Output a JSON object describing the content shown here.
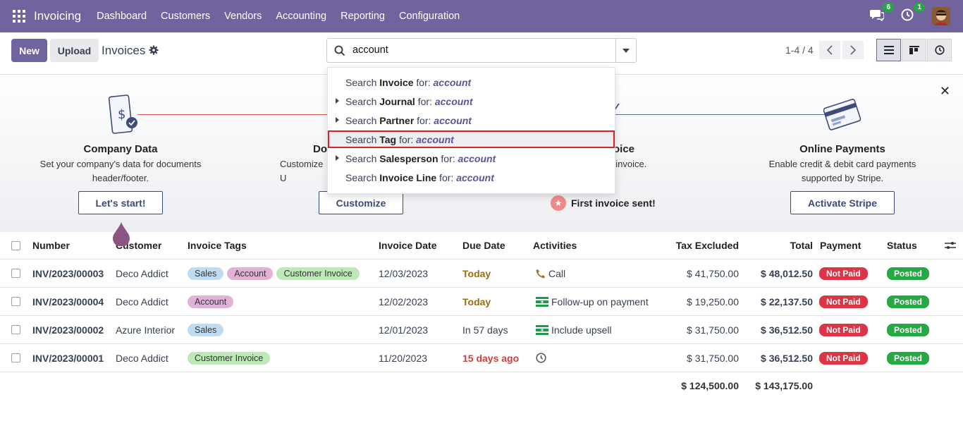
{
  "navbar": {
    "app_name": "Invoicing",
    "menu": [
      "Dashboard",
      "Customers",
      "Vendors",
      "Accounting",
      "Reporting",
      "Configuration"
    ],
    "messages_count": "6",
    "activities_count": "1",
    "bg_color": "#71639e"
  },
  "control": {
    "new_label": "New",
    "upload_label": "Upload",
    "breadcrumb": "Invoices",
    "search_value": "account",
    "pager": "1-4 / 4"
  },
  "search_dropdown": [
    {
      "prefix": "Search ",
      "field": "Invoice",
      "mid": " for: ",
      "term": "account",
      "expandable": false,
      "selected": false
    },
    {
      "prefix": "Search ",
      "field": "Journal",
      "mid": " for: ",
      "term": "account",
      "expandable": true,
      "selected": false
    },
    {
      "prefix": "Search ",
      "field": "Partner",
      "mid": " for: ",
      "term": "account",
      "expandable": true,
      "selected": false
    },
    {
      "prefix": "Search ",
      "field": "Tag",
      "mid": " for: ",
      "term": "account",
      "expandable": false,
      "selected": true
    },
    {
      "prefix": "Search ",
      "field": "Salesperson",
      "mid": " for: ",
      "term": "account",
      "expandable": true,
      "selected": false
    },
    {
      "prefix": "Search ",
      "field": "Invoice Line",
      "mid": " for: ",
      "term": "account",
      "expandable": false,
      "selected": false
    }
  ],
  "onboarding": {
    "step1": {
      "title": "Company Data",
      "desc_line1": "Set your company's data for documents",
      "desc_line2": "header/footer.",
      "button": "Let's start!"
    },
    "step2": {
      "title_part": "Do",
      "desc_part": "Customize U",
      "button": "Customize"
    },
    "step3": {
      "title_part": "oice",
      "desc_part": "t invoice.",
      "done": "First invoice sent!"
    },
    "step4": {
      "title": "Online Payments",
      "desc_line1": "Enable credit & debit card payments",
      "desc_line2": "supported by Stripe.",
      "button": "Activate Stripe"
    }
  },
  "table": {
    "headers": {
      "number": "Number",
      "customer": "Customer",
      "tags": "Invoice Tags",
      "invoice_date": "Invoice Date",
      "due_date": "Due Date",
      "activities": "Activities",
      "tax_excluded": "Tax Excluded",
      "total": "Total",
      "payment": "Payment",
      "status": "Status"
    },
    "rows": [
      {
        "number": "INV/2023/00003",
        "customer": "Deco Addict",
        "tags": [
          "Sales",
          "Account",
          "Customer Invoice"
        ],
        "invoice_date": "12/03/2023",
        "due_date": "Today",
        "due_type": "today",
        "activity_icon": "phone-icon",
        "activity": "Call",
        "tax_excluded": "$ 41,750.00",
        "total": "$ 48,012.50",
        "payment": "Not Paid",
        "status": "Posted"
      },
      {
        "number": "INV/2023/00004",
        "customer": "Deco Addict",
        "tags": [
          "Account"
        ],
        "invoice_date": "12/02/2023",
        "due_date": "Today",
        "due_type": "today",
        "activity_icon": "money-icon",
        "activity": "Follow-up on payment",
        "tax_excluded": "$ 19,250.00",
        "total": "$ 22,137.50",
        "payment": "Not Paid",
        "status": "Posted"
      },
      {
        "number": "INV/2023/00002",
        "customer": "Azure Interior",
        "tags": [
          "Sales"
        ],
        "invoice_date": "12/01/2023",
        "due_date": "In 57 days",
        "due_type": "normal",
        "activity_icon": "money-icon",
        "activity": "Include upsell",
        "tax_excluded": "$ 31,750.00",
        "total": "$ 36,512.50",
        "payment": "Not Paid",
        "status": "Posted"
      },
      {
        "number": "INV/2023/00001",
        "customer": "Deco Addict",
        "tags": [
          "Customer Invoice"
        ],
        "invoice_date": "11/20/2023",
        "due_date": "15 days ago",
        "due_type": "overdue",
        "activity_icon": "clock-icon",
        "activity": "",
        "tax_excluded": "$ 31,750.00",
        "total": "$ 36,512.50",
        "payment": "Not Paid",
        "status": "Posted"
      }
    ],
    "totals": {
      "tax_excluded": "$ 124,500.00",
      "total": "$ 143,175.00"
    }
  },
  "tag_colors": {
    "Sales": "#bfdcf2",
    "Account": "#e0b3d6",
    "Customer Invoice": "#bfe8b8"
  },
  "status_colors": {
    "not_paid": "#dc3545",
    "posted": "#28a745"
  }
}
